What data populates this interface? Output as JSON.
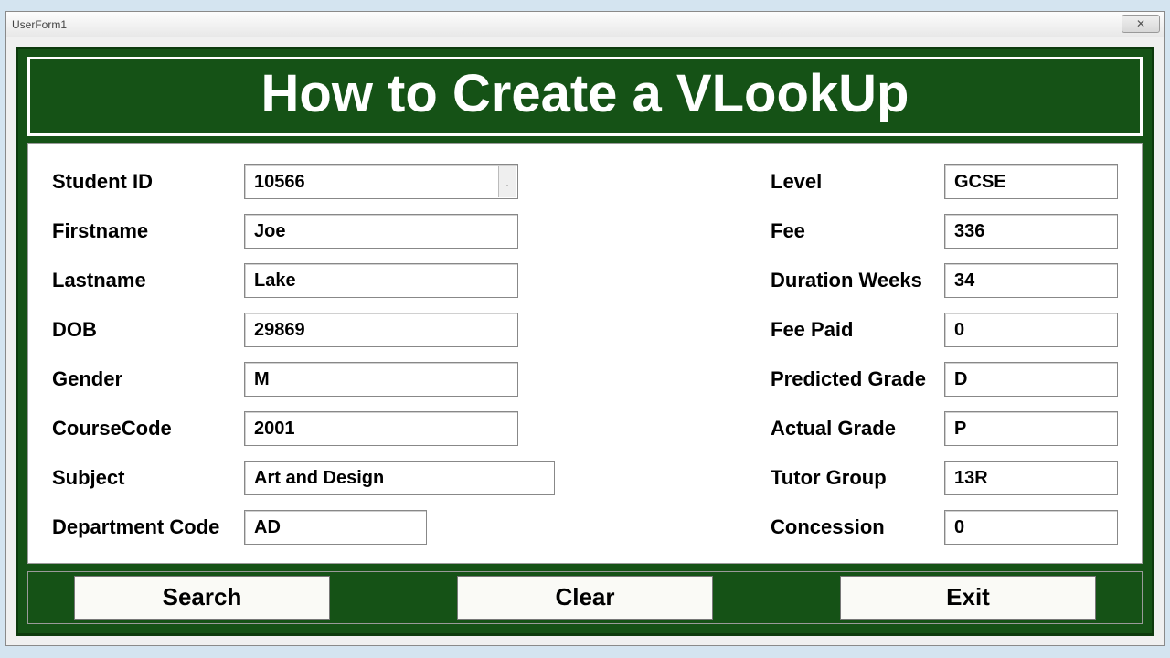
{
  "window": {
    "title": "UserForm1",
    "close": "✕"
  },
  "header": {
    "title": "How to Create a VLookUp"
  },
  "labels": {
    "student_id": "Student ID",
    "firstname": "Firstname",
    "lastname": "Lastname",
    "dob": "DOB",
    "gender": "Gender",
    "coursecode": "CourseCode",
    "subject": "Subject",
    "deptcode": "Department Code",
    "level": "Level",
    "fee": "Fee",
    "duration": "Duration Weeks",
    "feepaid": "Fee Paid",
    "predicted": "Predicted Grade",
    "actual": "Actual Grade",
    "tutor": "Tutor Group",
    "concession": "Concession"
  },
  "values": {
    "student_id": "10566",
    "firstname": "Joe",
    "lastname": "Lake",
    "dob": "29869",
    "gender": "M",
    "coursecode": "2001",
    "subject": "Art and Design",
    "deptcode": "AD",
    "level": "GCSE",
    "fee": "336",
    "duration": "34",
    "feepaid": "0",
    "predicted": "D",
    "actual": "P",
    "tutor": "13R",
    "concession": "0"
  },
  "buttons": {
    "search": "Search",
    "clear": "Clear",
    "exit": "Exit"
  }
}
